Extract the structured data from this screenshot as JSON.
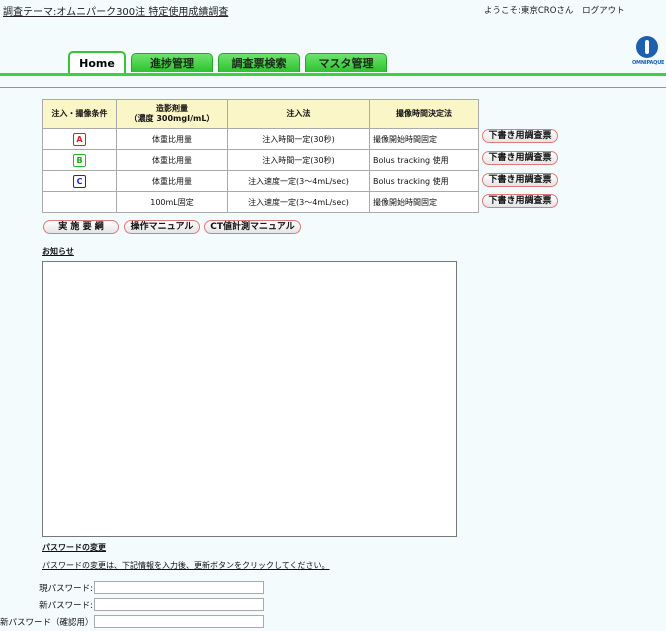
{
  "header": {
    "title": "調査テーマ:オムニパーク300注 特定使用成績調査",
    "welcome": "ようこそ:東京CROさん",
    "logout": "ログアウト",
    "logo_text": "OMNIPAQUE"
  },
  "tabs": [
    {
      "label": "Home",
      "active": true
    },
    {
      "label": "進捗管理",
      "active": false
    },
    {
      "label": "調査票検索",
      "active": false
    },
    {
      "label": "マスタ管理",
      "active": false
    }
  ],
  "table": {
    "headers": [
      "注入・撮像条件",
      "造影剤量",
      "（濃度 300mgI/mL）",
      "注入法",
      "撮像時間決定法"
    ],
    "rows": [
      {
        "badge": "A",
        "amount": "体重比用量",
        "method": "注入時間一定(30秒)",
        "timing": "撮像開始時間固定",
        "button": "下書き用調査票"
      },
      {
        "badge": "B",
        "amount": "体重比用量",
        "method": "注入時間一定(30秒)",
        "timing": "Bolus tracking 使用",
        "button": "下書き用調査票"
      },
      {
        "badge": "C",
        "amount": "体重比用量",
        "method": "注入速度一定(3～4mL/sec)",
        "timing": "Bolus tracking 使用",
        "button": "下書き用調査票"
      },
      {
        "badge": "",
        "amount": "100mL固定",
        "method": "注入速度一定(3～4mL/sec)",
        "timing": "撮像開始時間固定",
        "button": "下書き用調査票"
      }
    ]
  },
  "buttons": {
    "plan": "実 施 要 綱",
    "manual": "操作マニュアル",
    "ct_manual": "CT値計測マニュアル"
  },
  "news": {
    "title": "お知らせ"
  },
  "password": {
    "title": "パスワードの変更",
    "description": "パスワードの変更は、下記情報を入力後、更新ボタンをクリックしてください。",
    "current_label": "現パスワード:",
    "new_label": "新パスワード:",
    "confirm_label": "新パスワード（確認用）:",
    "current_value": "",
    "new_value": "",
    "confirm_value": ""
  },
  "colors": {
    "tab_green": "#2dc22d",
    "header_bg": "#fbf6c7",
    "accent_red": "#e07a7a",
    "background": "#f4fbfd"
  }
}
